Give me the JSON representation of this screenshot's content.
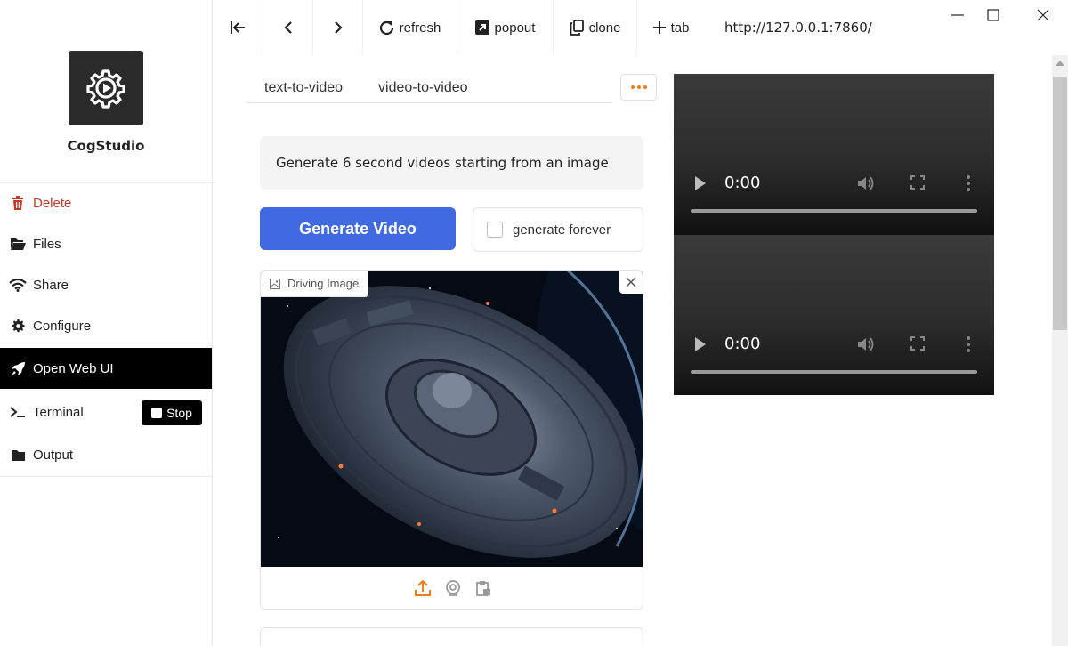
{
  "sidebar": {
    "app_name": "CogStudio",
    "items": [
      {
        "label": "Delete",
        "icon": "trash-icon"
      },
      {
        "label": "Files",
        "icon": "folder-open-icon"
      },
      {
        "label": "Share",
        "icon": "wifi-icon"
      },
      {
        "label": "Configure",
        "icon": "gear-icon"
      },
      {
        "label": "Open Web UI",
        "icon": "rocket-icon"
      },
      {
        "label": "Terminal",
        "icon": "terminal-icon"
      },
      {
        "label": "Output",
        "icon": "folder-icon"
      }
    ],
    "stop_label": "Stop"
  },
  "toolbar": {
    "refresh_label": "refresh",
    "popout_label": "popout",
    "clone_label": "clone",
    "tab_label": "tab",
    "url": "http://127.0.0.1:7860/"
  },
  "main": {
    "tabs": [
      {
        "label": "text-to-video"
      },
      {
        "label": "video-to-video"
      }
    ],
    "description": "Generate 6 second videos starting from an image",
    "generate_label": "Generate Video",
    "forever_label": "generate forever",
    "image_label": "Driving Image"
  },
  "videos": [
    {
      "time": "0:00"
    },
    {
      "time": "0:00"
    }
  ],
  "colors": {
    "accent_blue": "#4169e1",
    "danger_red": "#c0392b",
    "more_dots_orange": "#f27c1d"
  }
}
